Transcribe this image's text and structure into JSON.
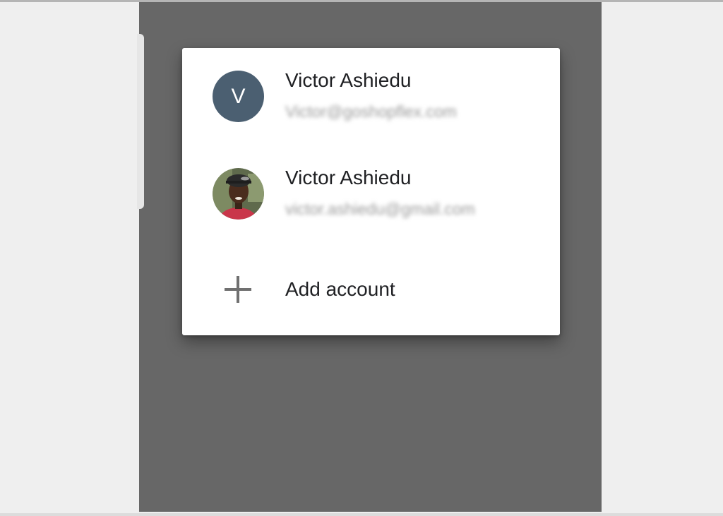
{
  "account_chooser": {
    "accounts": [
      {
        "avatar_initial": "V",
        "avatar_color": "#4b5f71",
        "name": "Victor Ashiedu",
        "email": "Victor@goshopflex.com"
      },
      {
        "avatar_icon": "profile-photo",
        "name": "Victor Ashiedu",
        "email": "victor.ashiedu@gmail.com"
      }
    ],
    "add_account_label": "Add account",
    "add_account_icon": "plus-icon"
  }
}
